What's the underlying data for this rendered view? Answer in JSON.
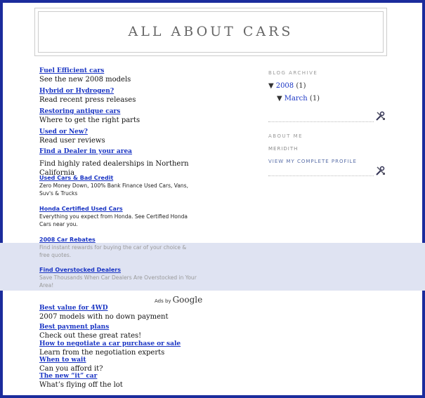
{
  "blog_title": "ALL ABOUT CARS",
  "links": [
    {
      "title": "Fuel Efficient cars",
      "desc": "See the new 2008 models"
    },
    {
      "title": "Hybrid or Hydrogen?",
      "desc": "Read recent press releases"
    },
    {
      "title": "Restoring antique cars",
      "desc": "Where to get the right parts"
    },
    {
      "title": "Used or New?",
      "desc": "Read user reviews"
    },
    {
      "title": "Find a Dealer in your area",
      "desc": "Find highly rated dealerships in Northern California"
    }
  ],
  "ads": [
    {
      "title": "Used Cars & Bad Credit",
      "desc": "Zero Money Down, 100% Bank Finance Used Cars, Vans, Suv's & Trucks"
    },
    {
      "title": "Honda Certified Used Cars",
      "desc": "Everything you expect from Honda. See Certified Honda Cars near you."
    },
    {
      "title": "2008 Car Rebates",
      "desc": "Find instant rewards for buying the car of your choice & free quotes."
    },
    {
      "title": "Find Overstocked Dealers",
      "desc": "Save Thousands When Car Dealers Are Overstocked in Your Area!"
    }
  ],
  "ads_by": "Ads by",
  "google": "Google",
  "links2": [
    {
      "title": "Best value for 4WD",
      "desc": "2007 models  with no down payment"
    },
    {
      "title": "Best payment plans",
      "desc": "Check out these great rates!"
    },
    {
      "title": "How to negotiate a car purchase or sale",
      "desc": "Learn from the negotiation experts"
    },
    {
      "title": "When to wait",
      "desc": "Can you afford it?"
    },
    {
      "title": "The new “it” car",
      "desc": "What’s flying off the lot"
    }
  ],
  "sidebar": {
    "archive_heading": "BLOG ARCHIVE",
    "year": "2008",
    "year_count": "(1)",
    "month": "March",
    "month_count": "(1)",
    "about_heading": "ABOUT ME",
    "author": "MERIDITH",
    "profile_link": "VIEW MY COMPLETE PROFILE"
  },
  "colors": {
    "border": "#1b2c9c",
    "link": "#1a35c4"
  },
  "icons": {
    "archive_edit": "wrench-screwdriver-icon",
    "about_edit": "wrench-screwdriver-icon",
    "archive_expander": "triangle-down-icon"
  }
}
